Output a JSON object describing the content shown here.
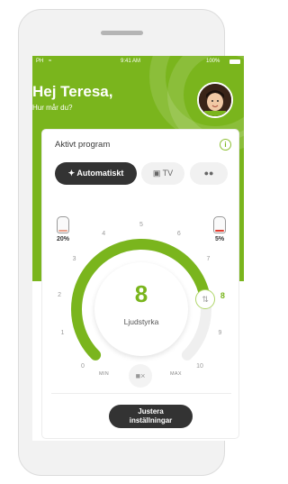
{
  "status_bar": {
    "carrier": "PH",
    "time": "9:41 AM",
    "battery": "100%"
  },
  "header": {
    "greeting": "Hej Teresa,",
    "subtitle": "Hur mår du?"
  },
  "program": {
    "title": "Aktivt program",
    "tabs": [
      {
        "label": "Automatiskt",
        "icon": "wand-icon",
        "active": true
      },
      {
        "label": "TV",
        "icon": "tv-icon",
        "active": false
      },
      {
        "label": "",
        "icon": "people-icon",
        "active": false
      }
    ]
  },
  "hearing_aids": {
    "left": {
      "battery": "20%"
    },
    "right": {
      "battery": "5%"
    }
  },
  "volume": {
    "value": "8",
    "label": "Ljudstyrka",
    "handle_value": "8",
    "level": 0.8,
    "ticks": [
      "0",
      "1",
      "2",
      "3",
      "4",
      "5",
      "6",
      "7",
      "8",
      "9",
      "10"
    ],
    "min_label": "MIN",
    "max_label": "MAX"
  },
  "adjust_button": {
    "line1": "Justera",
    "line2": "inställningar"
  },
  "colors": {
    "accent": "#7ab51d",
    "dark": "#333333",
    "warning": "#e23b2e"
  }
}
